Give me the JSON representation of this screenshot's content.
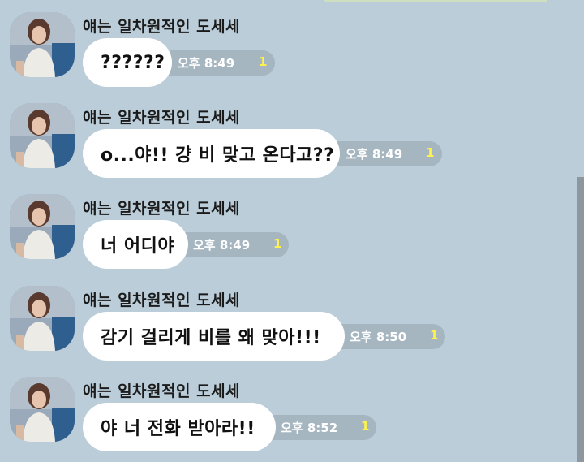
{
  "chat": {
    "messages": [
      {
        "sender": "얘는 일차원적인 도세세",
        "text": "??????",
        "time": "오후 8:49",
        "unread": "1"
      },
      {
        "sender": "얘는 일차원적인 도세세",
        "text": "o...야!! 걍 비 맞고 온다고??",
        "time": "오후 8:49",
        "unread": "1"
      },
      {
        "sender": "얘는 일차원적인 도세세",
        "text": "너 어디야",
        "time": "오후 8:49",
        "unread": "1"
      },
      {
        "sender": "얘는 일차원적인 도세세",
        "text": "감기 걸리게 비를 왜 맞아!!!",
        "time": "오후 8:50",
        "unread": "1"
      },
      {
        "sender": "얘는 일차원적인 도세세",
        "text": "야 너 전화 받아라!!",
        "time": "오후 8:52",
        "unread": "1"
      }
    ]
  },
  "colors": {
    "background": "#bacdd9",
    "bubble": "#ffffff",
    "meta_pill": "#a6b6c1",
    "unread": "#fff24a"
  }
}
